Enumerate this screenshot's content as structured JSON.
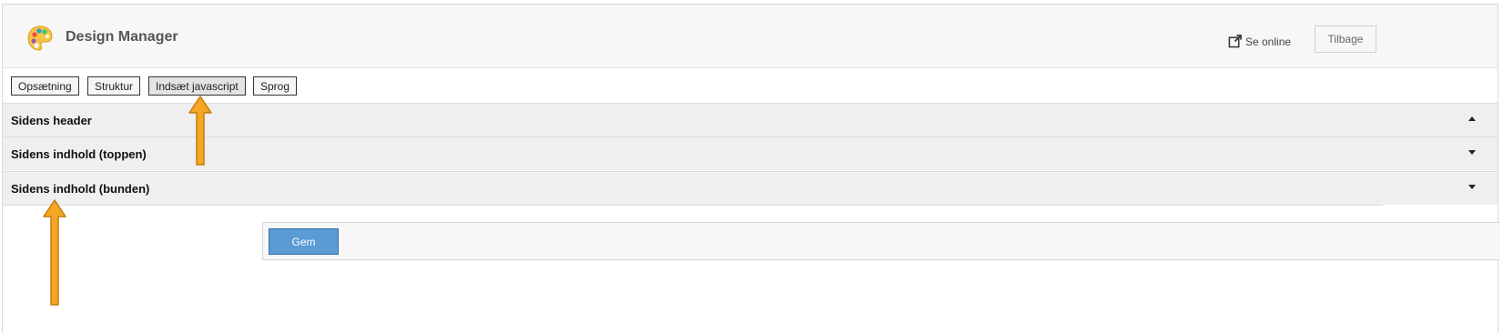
{
  "app": {
    "title": "Design Manager",
    "logo_icon": "palette-icon"
  },
  "header": {
    "online_label": "Se online",
    "online_icon": "external-link-icon",
    "back_label": "Tilbage"
  },
  "tabs": [
    {
      "label": "Opsætning",
      "active": false
    },
    {
      "label": "Struktur",
      "active": false
    },
    {
      "label": "Indsæt javascript",
      "active": true
    },
    {
      "label": "Sprog",
      "active": false
    }
  ],
  "sections": [
    {
      "label": "Sidens header",
      "caret": "up"
    },
    {
      "label": "Sidens indhold (toppen)",
      "caret": "down"
    },
    {
      "label": "Sidens indhold (bunden)",
      "caret": "down"
    }
  ],
  "save": {
    "label": "Gem"
  },
  "colors": {
    "accent": "#5b9bd5",
    "annotation_arrow": "#f5a623"
  }
}
